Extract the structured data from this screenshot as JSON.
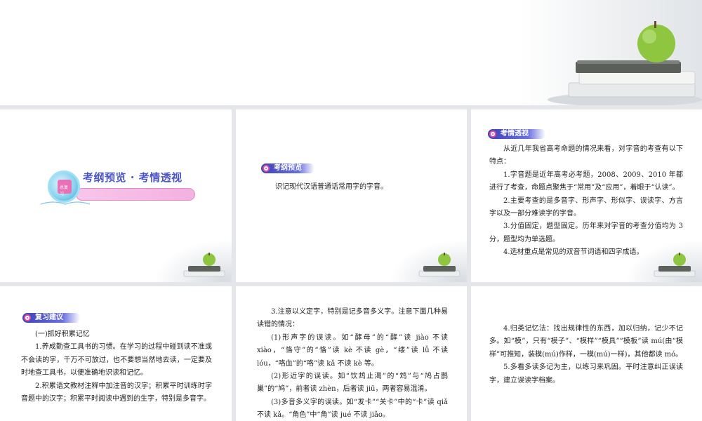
{
  "slide1": {
    "badge": "总复习",
    "title": "考纲预览 · 考情透视"
  },
  "slide2": {
    "tag": "考纲预览",
    "body": "识记现代汉语普通话常用字的字音。"
  },
  "slide3": {
    "tag": "考情透视",
    "paras": [
      "从近几年我省高考命题的情况来看，对字音的考查有以下特点：",
      "1.字音题是近年高考必考题，2008、2009、2010 年都进行了考查，命题点聚焦于“常用”及“应用”，着眼于“认读”。",
      "2.主要考查的是多音字、形声字、形似字、误读字、方言字以及一部分难读字的字音。",
      "3.分值固定，题型固定。历年来对字音的考查分值均为 3 分，题型均为单选题。",
      "4.选材重点是常见的双音节词语和四字成语。"
    ]
  },
  "slide4": {
    "tag": "复习建议",
    "paras": [
      "(一)抓好积累记忆",
      "1.养成勤查工具书的习惯。在学习的过程中碰到读不准或不会读的字，千万不可放过，也不要想当然地去读，一定要及时地查工具书，以便准确地识读和记忆。",
      "2.积累语文教材注释中加注音的汉字；积累平时训练时字音题中的汉字；积累平时阅读中遇到的生字，特别是多音字。"
    ]
  },
  "slide5": {
    "paras": [
      "3.注意以义定字，特别是记多音多义字。注意下面几种易读错的情况：",
      "(1)形声字的误读。如“酵母”的“酵”读 jiào 不读 xiào，“恪守”的“恪”读 kè 不读 gè，“缕”读 lǚ 不读 lóu，“咯血”的“咯”读 kǎ 不读 kè 等。",
      "(2)形近字的误读。如“饮鸩止渴”的“鸩”与“鸠占鹊巢”的“鸠”，前者读 zhèn，后者读 jiū，两者容易混淆。",
      "(3)多音多义字的误读。如“发卡”“关卡”中的“卡”读 qiǎ 不读 kǎ。“角色”中“角”读 jué 不读 jiǎo。"
    ]
  },
  "slide6": {
    "paras": [
      "4.归类记忆法：找出规律性的东西，加以归纳，记少不记多。如“模”，只有“模子”、“模样”“模具”“模板”读 mú(由“模样”可推知，装模(mú)作样，一模(mú)一样)，其他都读 mó。",
      "5.多看多读多记为主，以练习来巩固。平时注意纠正误读字，建立误读字档案。"
    ]
  }
}
